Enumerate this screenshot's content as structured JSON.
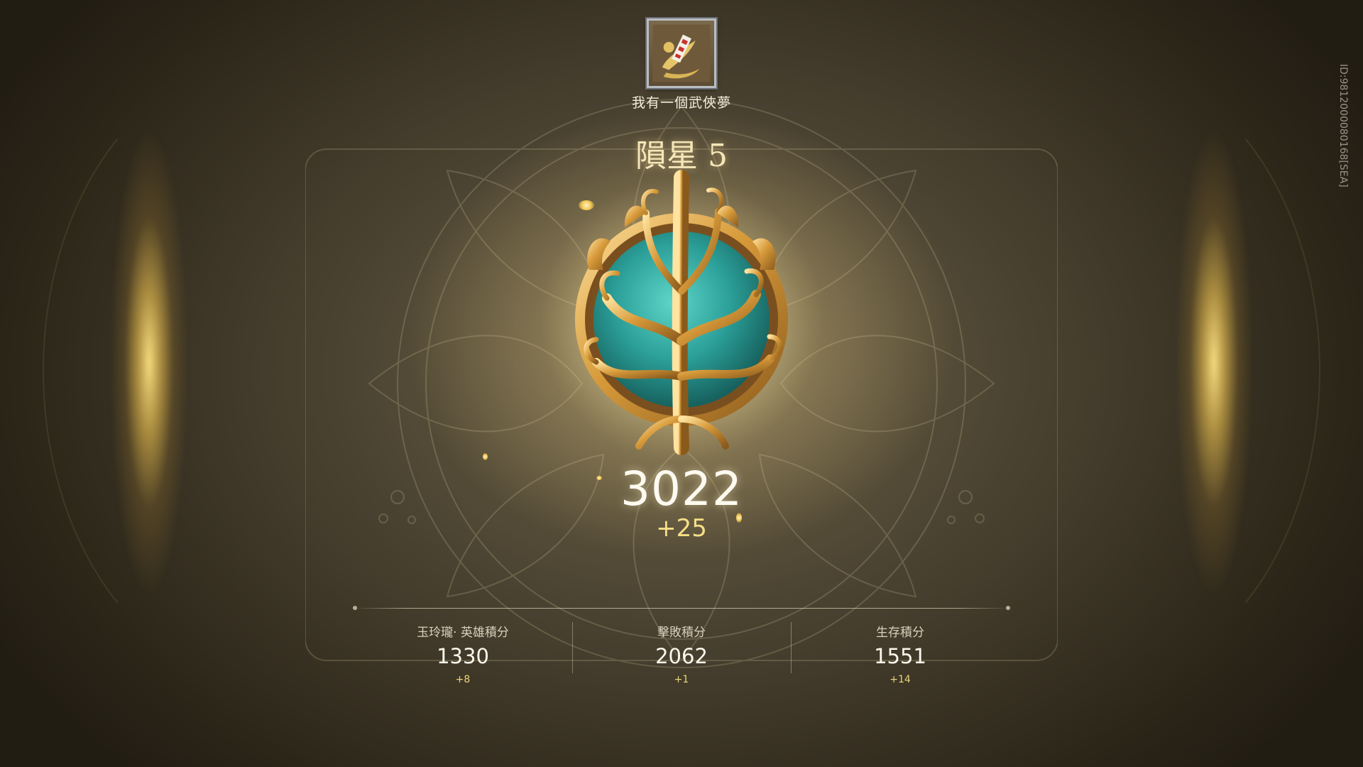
{
  "title": {
    "emblem_icon": "title-emblem-icon",
    "name": "我有一個武俠夢"
  },
  "rank": {
    "name": "隕星 5",
    "badge_icon": "tree-orb-rank-badge-icon",
    "score": "3022",
    "score_delta": "+25"
  },
  "stats": [
    {
      "label": "玉玲瓏· 英雄積分",
      "value": "1330",
      "delta": "+8"
    },
    {
      "label": "擊敗積分",
      "value": "2062",
      "delta": "+1"
    },
    {
      "label": "生存積分",
      "value": "1551",
      "delta": "+14"
    }
  ],
  "player_id": "ID:9812000080168[SEA]",
  "colors": {
    "gold": "#f6df86",
    "turquoise": "#2fa8a0",
    "text": "#efe8d6"
  }
}
